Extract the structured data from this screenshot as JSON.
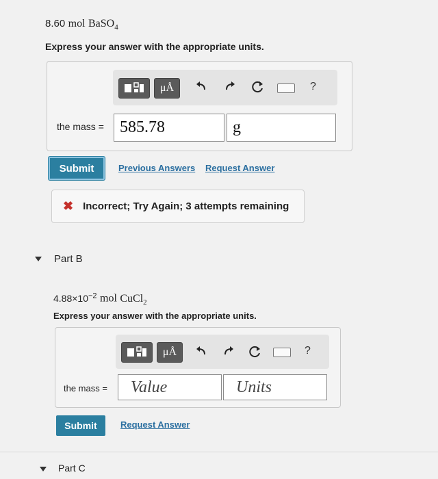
{
  "partA": {
    "problem_qty": "8.60",
    "problem_unit": "mol",
    "problem_formula_base": "BaSO",
    "problem_formula_sub": "4",
    "instructions": "Express your answer with the appropriate units.",
    "toolbar": {
      "mu_label": "μÅ",
      "help": "?"
    },
    "answer_label": "the mass =",
    "value": "585.78",
    "units": "g",
    "submit_label": "Submit",
    "previous_answers_label": "Previous Answers",
    "request_answer_label": "Request Answer",
    "feedback_mark": "✖",
    "feedback_text": "Incorrect; Try Again; 3 attempts remaining"
  },
  "partB": {
    "title": "Part B",
    "problem_coef": "4.88×10",
    "problem_exp": "−2",
    "problem_unit": "mol",
    "problem_formula_base": "CuCl",
    "problem_formula_sub": "2",
    "instructions": "Express your answer with the appropriate units.",
    "toolbar": {
      "mu_label": "μÅ",
      "help": "?"
    },
    "answer_label": "the mass =",
    "value_placeholder": "Value",
    "units_placeholder": "Units",
    "submit_label": "Submit",
    "request_answer_label": "Request Answer"
  },
  "partC": {
    "title": "Part C"
  },
  "colors": {
    "submit": "#2b7fa0",
    "link": "#2b6fa0",
    "error": "#c4302b"
  }
}
